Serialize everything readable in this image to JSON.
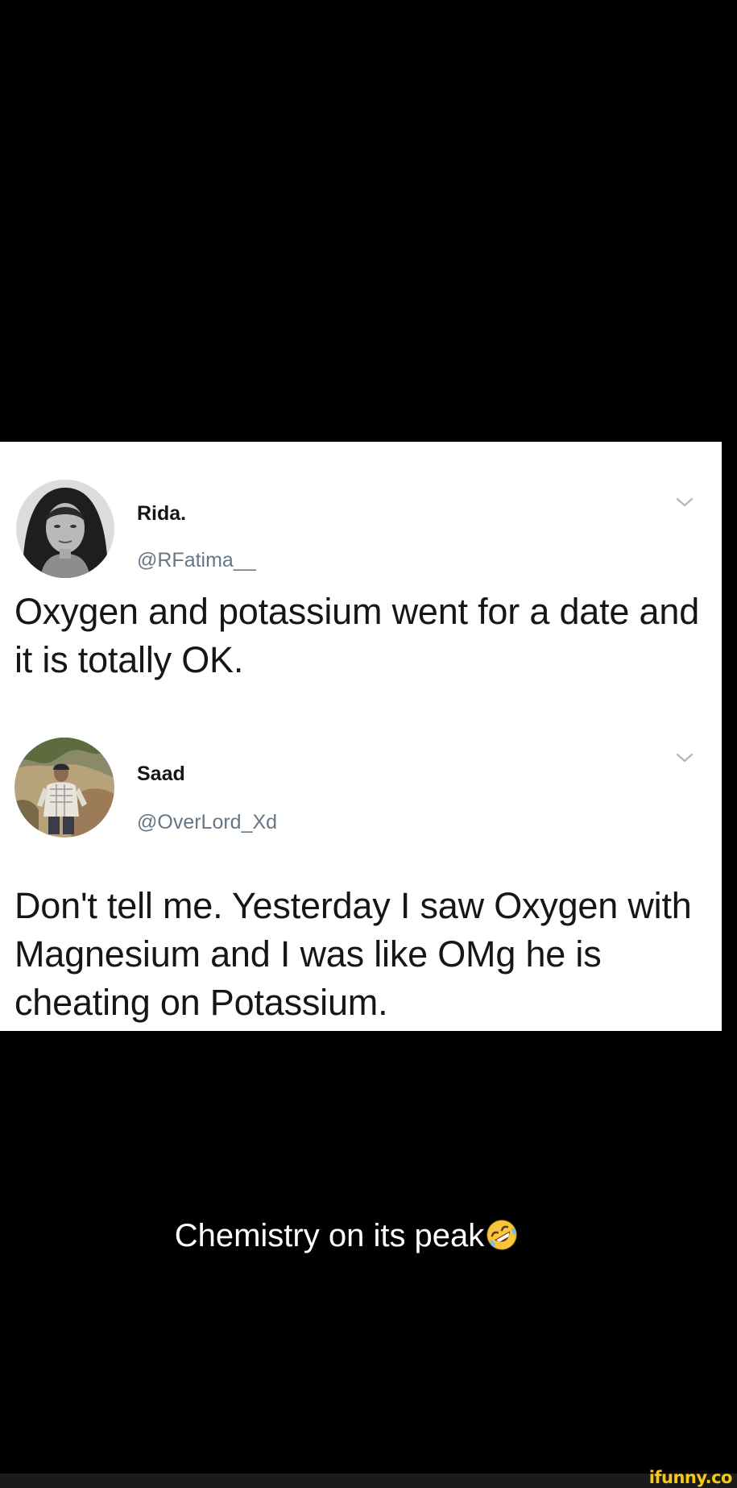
{
  "tweets": [
    {
      "name": "Rida.",
      "handle": "@RFatima__",
      "text": "Oxygen and potassium went for a date and it is totally OK.",
      "avatar_icon": "profile-photo-woman",
      "menu_icon": "chevron-down-icon"
    },
    {
      "name": "Saad",
      "handle": "@OverLord_Xd",
      "text": "Don't tell me. Yesterday I saw Oxygen with Magnesium and I was like OMg he is cheating on Potassium.",
      "avatar_icon": "profile-photo-man-outdoors",
      "menu_icon": "chevron-down-icon"
    }
  ],
  "caption": {
    "text": "Chemistry on its peak",
    "emoji_icon": "rolling-on-the-floor-laughing-emoji"
  },
  "watermark": {
    "text": "ifunny.co"
  },
  "colors": {
    "background": "#000000",
    "card": "#ffffff",
    "text_primary": "#14171a",
    "text_secondary": "#657786",
    "watermark": "#f7c916"
  }
}
